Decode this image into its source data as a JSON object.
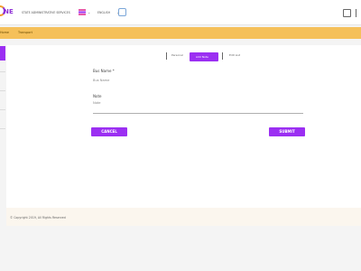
{
  "header": {
    "logo": "NE",
    "link_1": "STATE ADMINISTRATIVE SERVICES",
    "link_2": "ENGLISH"
  },
  "navbar": {
    "item_1": "Home",
    "item_2": "Transport"
  },
  "tabs": {
    "tab_1": "Personal",
    "tab_2": "Add Note",
    "tab_3": "Edit List"
  },
  "form": {
    "field_1_label": "Bus Name *",
    "field_1_value": "Bus Name",
    "field_2_label": "Note",
    "field_2_value": "Note"
  },
  "actions": {
    "cancel": "CANCEL",
    "submit": "SUBMIT"
  },
  "footer": {
    "text": "© Copyright 2019, All Rights Reserved"
  }
}
